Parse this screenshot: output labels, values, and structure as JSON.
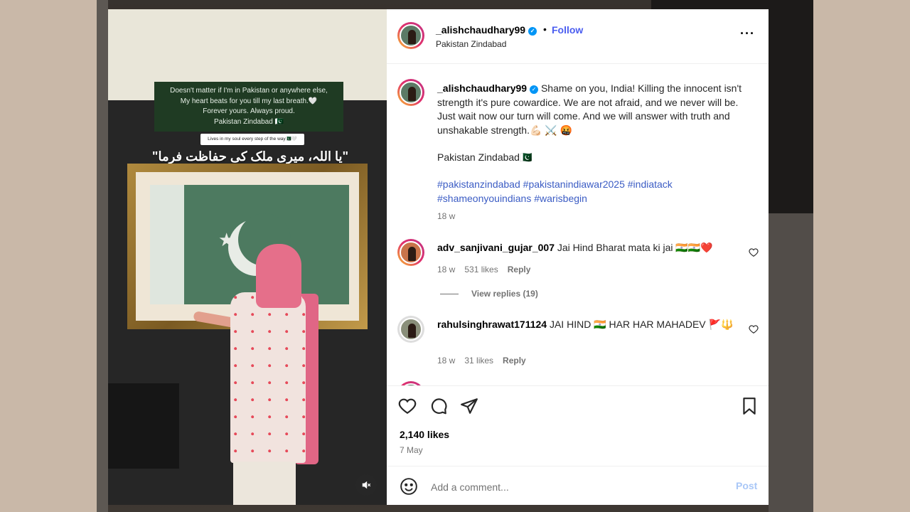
{
  "colors": {
    "accent": "#0095f6",
    "follow": "#4a5df0",
    "hashtag": "#3b5cc4",
    "heart": "#e0245e"
  },
  "post": {
    "username": "_alishchaudhary99",
    "follow_separator": "•",
    "follow_label": "Follow",
    "location": "Pakistan Zindabad",
    "more_icon": "more-horizontal-icon"
  },
  "media": {
    "overlay_lines": [
      "Doesn't matter if I'm in Pakistan or anywhere else,",
      "My heart beats for you till my last breath.🤍",
      "Forever yours. Always proud.",
      "Pakistan Zindabad 🇵🇰"
    ],
    "overlay_chip": "Lives in my soul every step of the way🇵🇰🤍",
    "urdu_text": "\"یا اللہ، میری ملک کی حفاظت فرما\"",
    "mute_icon": "speaker-muted-icon"
  },
  "caption": {
    "username": "_alishchaudhary99",
    "text": " Shame on you, India! Killing the innocent isn't strength it's pure cowardice. We are not afraid, and we never will be. Just wait now our turn will come. And we will answer with truth and unshakable strength.💪🏻 ⚔️ 🤬",
    "footer_line": "Pakistan Zindabad🇵🇰",
    "hashtags": [
      "#pakistanzindabad",
      "#pakistanindiawar2025",
      "#indiatack",
      "#shameonyouindians",
      "#warisbegin"
    ],
    "time": "18 w"
  },
  "comments": [
    {
      "username": "adv_sanjivani_gujar_007",
      "text": " Jai Hind Bharat mata ki jai 🇮🇳🇮🇳❤️",
      "time": "18 w",
      "likes": "531 likes",
      "reply": "Reply",
      "view_replies": "View replies (19)"
    },
    {
      "username": "rahulsinghrawat171124",
      "text": " JAI HIND 🇮🇳 HAR HAR MAHADEV 🚩🔱",
      "time": "18 w",
      "likes": "31 likes",
      "reply": "Reply"
    }
  ],
  "actions": {
    "like_icon": "heart-icon",
    "comment_icon": "comment-icon",
    "share_icon": "share-icon",
    "save_icon": "bookmark-icon",
    "likes_count": "2,140 likes",
    "date": "7 May"
  },
  "add_comment": {
    "emoji_icon": "emoji-icon",
    "placeholder": "Add a comment...",
    "post_label": "Post"
  }
}
